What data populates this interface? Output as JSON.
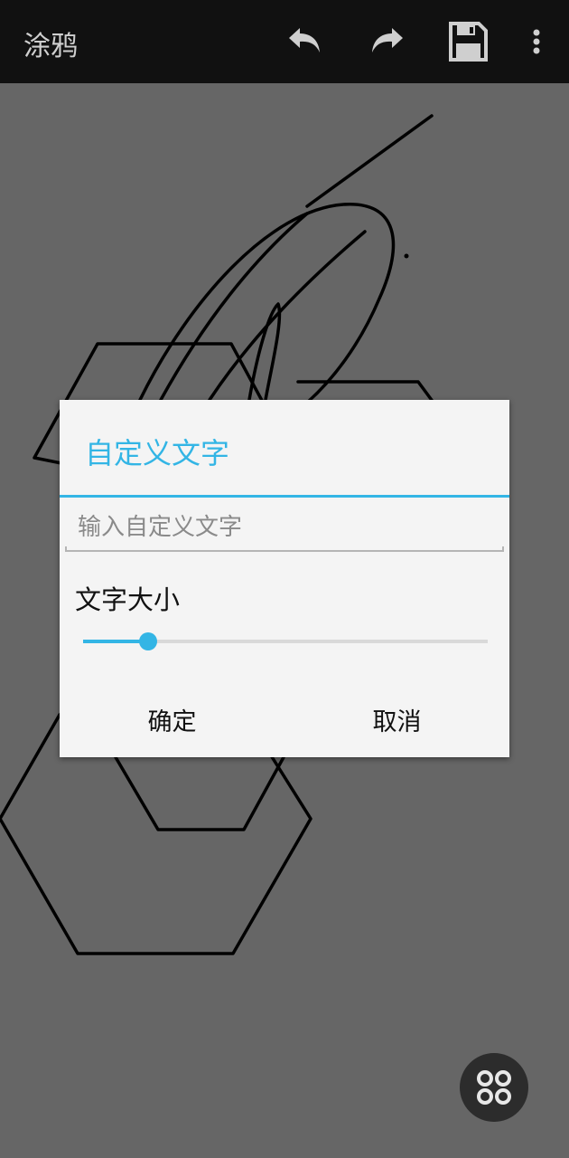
{
  "app": {
    "title": "涂鸦",
    "toolbar_icons": [
      "undo-icon",
      "redo-icon",
      "save-icon",
      "more-vert-icon"
    ]
  },
  "dialog": {
    "title": "自定义文字",
    "input_value": "",
    "input_placeholder": "输入自定义文字",
    "size_label": "文字大小",
    "size_slider_fraction": 0.16,
    "confirm_label": "确定",
    "cancel_label": "取消"
  },
  "fab": {
    "icon": "four-circles-menu-icon"
  },
  "colors": {
    "accent": "#33b5e5",
    "toolbar_bg": "#111111",
    "canvas_bg": "#666666",
    "dialog_bg": "#f4f4f4",
    "stroke": "#000000"
  }
}
